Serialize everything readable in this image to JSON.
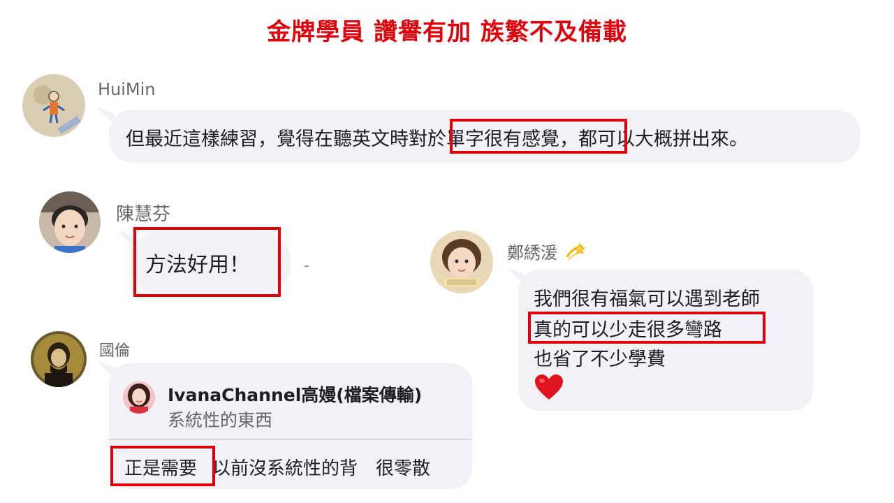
{
  "title": "金牌學員 讚譽有加 族繁不及備載",
  "colors": {
    "highlight": "#e0000b",
    "bubble": "#f0f2f5",
    "name": "#65676b"
  },
  "comments": [
    {
      "author": "HuiMin",
      "avatar": "child-drawing-avatar",
      "text_before": "但最近這樣練習，覺得在聽英文時",
      "text_highlight": "對於單字很有感覺",
      "text_after": "，都可以大概拼出來。"
    },
    {
      "author": "陳慧芬",
      "avatar": "boy-photo-avatar",
      "text": "方法好用！"
    },
    {
      "author": "鄭綉湲",
      "author_icon": "dizzy-star-icon",
      "avatar": "girl-photo-avatar",
      "lines": [
        "我們很有福氣可以遇到老師",
        "真的可以少走很多彎路",
        "也省了不少學費"
      ],
      "heart_icon": "red-heart-icon"
    },
    {
      "author": "國倫",
      "avatar": "portrait-avatar",
      "quote": {
        "author": "IvanaChannel高嫚(檔案傳輸)",
        "text": "系統性的東西"
      },
      "reply_highlight": "正是需要",
      "reply_rest": "以前沒系統性的背　很零散"
    }
  ]
}
